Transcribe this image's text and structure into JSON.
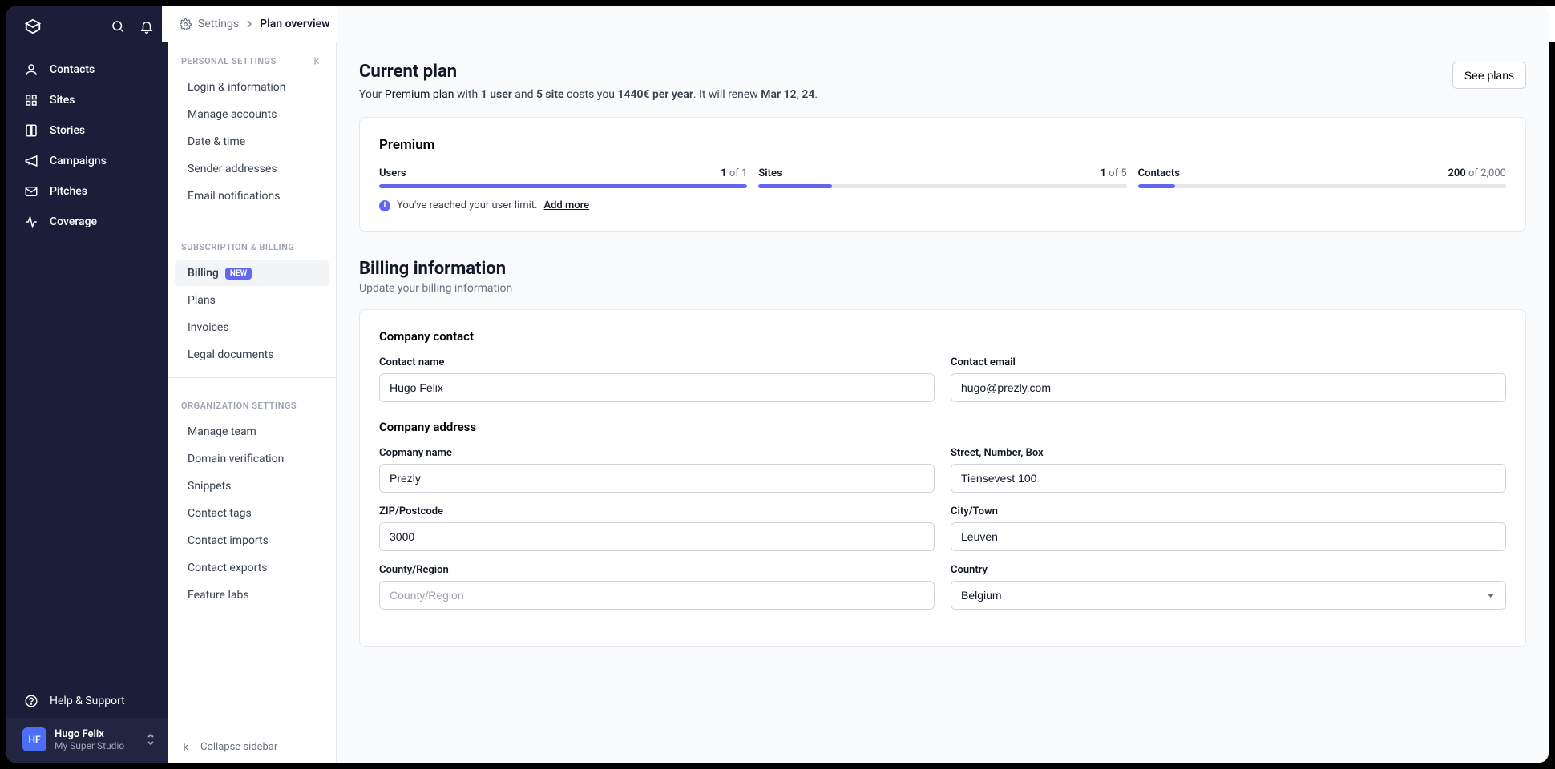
{
  "nav": {
    "items": [
      {
        "label": "Contacts"
      },
      {
        "label": "Sites"
      },
      {
        "label": "Stories"
      },
      {
        "label": "Campaigns"
      },
      {
        "label": "Pitches"
      },
      {
        "label": "Coverage"
      }
    ],
    "help": "Help & Support",
    "user": {
      "initials": "HF",
      "name": "Hugo Felix",
      "studio": "My Super Studio"
    }
  },
  "breadcrumb": {
    "root": "Settings",
    "current": "Plan overview"
  },
  "settings": {
    "personal_header": "Personal Settings",
    "personal": [
      "Login & information",
      "Manage accounts",
      "Date & time",
      "Sender addresses",
      "Email notifications"
    ],
    "billing_header": "Subscription & Billing",
    "billing": [
      {
        "label": "Billing",
        "badge": "NEW",
        "active": true
      },
      {
        "label": "Plans"
      },
      {
        "label": "Invoices"
      },
      {
        "label": "Legal documents"
      }
    ],
    "org_header": "Organization Settings",
    "org": [
      "Manage team",
      "Domain verification",
      "Snippets",
      "Contact tags",
      "Contact imports",
      "Contact exports",
      "Feature labs"
    ],
    "collapse": "Collapse sidebar"
  },
  "plan": {
    "title": "Current plan",
    "summary": {
      "prefix": "Your ",
      "plan_link": "Premium plan",
      "with": " with ",
      "users": "1 user",
      "and": " and ",
      "sites": "5 site",
      "costs": " costs you ",
      "price": "1440€ per year",
      "renew_prefix": ". It will renew ",
      "renew_date": "Mar 12, 24",
      "suffix": "."
    },
    "see_plans": "See plans",
    "card_title": "Premium",
    "usage": {
      "users": {
        "label": "Users",
        "current": "1",
        "total": "1",
        "pct": 100
      },
      "sites": {
        "label": "Sites",
        "current": "1",
        "total": "5",
        "pct": 20
      },
      "contacts": {
        "label": "Contacts",
        "current": "200",
        "total": "2,000",
        "pct": 10
      }
    },
    "alert": {
      "text": "You've reached your user limit.",
      "link": "Add more"
    }
  },
  "billing_info": {
    "title": "Billing information",
    "subtitle": "Update your billing information",
    "company_contact_header": "Company contact",
    "company_address_header": "Company address",
    "fields": {
      "contact_name": {
        "label": "Contact name",
        "value": "Hugo Felix"
      },
      "contact_email": {
        "label": "Contact email",
        "value": "hugo@prezly.com"
      },
      "company_name": {
        "label": "Copmany name",
        "value": "Prezly"
      },
      "street": {
        "label": "Street, Number, Box",
        "value": "Tiensevest 100"
      },
      "zip": {
        "label": "ZIP/Postcode",
        "value": "3000"
      },
      "city": {
        "label": "City/Town",
        "value": "Leuven"
      },
      "county": {
        "label": "County/Region",
        "value": "",
        "placeholder": "County/Region"
      },
      "country": {
        "label": "Country",
        "value": "Belgium"
      }
    }
  },
  "of_label": "of"
}
